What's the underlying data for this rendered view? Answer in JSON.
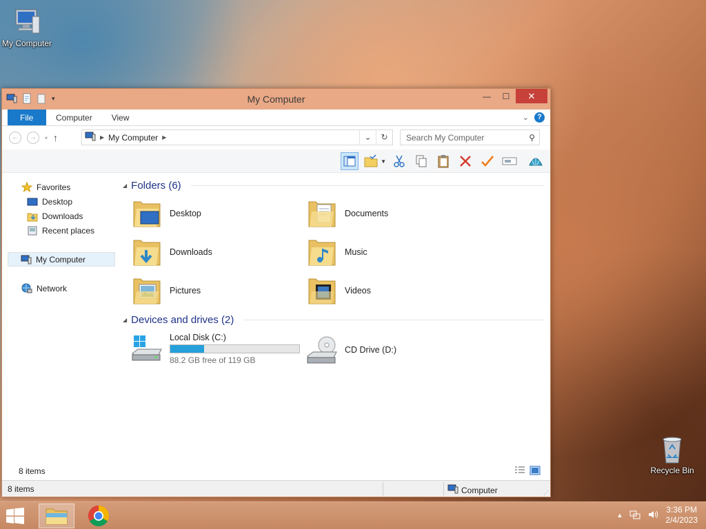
{
  "desktop": {
    "icons": [
      {
        "label": "My Computer"
      },
      {
        "label": "Recycle Bin"
      }
    ]
  },
  "window": {
    "title": "My Computer",
    "ribbon_tabs": [
      "File",
      "Computer",
      "View"
    ],
    "address": {
      "path": "My Computer"
    },
    "search": {
      "placeholder": "Search My Computer"
    },
    "nav_pane": {
      "favorites": "Favorites",
      "favorites_items": [
        "Desktop",
        "Downloads",
        "Recent places"
      ],
      "my_computer": "My Computer",
      "network": "Network"
    },
    "groups": {
      "folders_title": "Folders (6)",
      "folders": [
        "Desktop",
        "Documents",
        "Downloads",
        "Music",
        "Pictures",
        "Videos"
      ],
      "drives_title": "Devices and drives (2)",
      "drives": [
        {
          "name": "Local Disk (C:)",
          "free_text": "88.2 GB free of 119 GB",
          "used_fraction": 0.26
        },
        {
          "name": "CD Drive (D:)"
        }
      ]
    },
    "items_count": "8 items",
    "status": {
      "left": "8 items",
      "right": "Computer"
    }
  },
  "taskbar": {
    "time": "3:36 PM",
    "date": "2/4/2023"
  },
  "colors": {
    "accent": "#1979ca",
    "close": "#c7413a",
    "drive_bar": "#26a0da",
    "title_bar": "#e9a886"
  }
}
